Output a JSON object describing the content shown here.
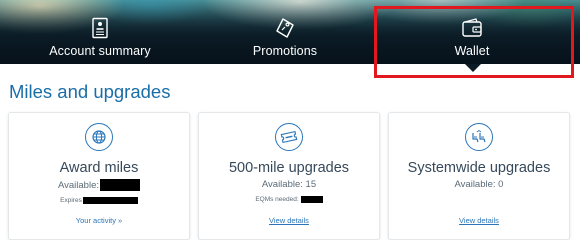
{
  "tabs": [
    {
      "label": "Account summary",
      "icon": "document-icon"
    },
    {
      "label": "Promotions",
      "icon": "tag-icon"
    },
    {
      "label": "Wallet",
      "icon": "wallet-icon",
      "active": true
    }
  ],
  "highlight_color": "#e1191f",
  "section": {
    "title": "Miles and upgrades"
  },
  "cards": [
    {
      "title": "Award miles",
      "icon": "globe-icon",
      "line_label": "Available:",
      "sub_label": "Expires",
      "link": "Your activity »"
    },
    {
      "title": "500-mile upgrades",
      "icon": "ticket-icon",
      "line_label": "Available: 15",
      "sub_label": "EQMs needed:",
      "link": "View details"
    },
    {
      "title": "Systemwide upgrades",
      "icon": "seats-icon",
      "line_label": "Available: 0",
      "link": "View details"
    }
  ],
  "colors": {
    "accent": "#2b76b9",
    "heading": "#1a6ea8",
    "text": "#36495a"
  }
}
